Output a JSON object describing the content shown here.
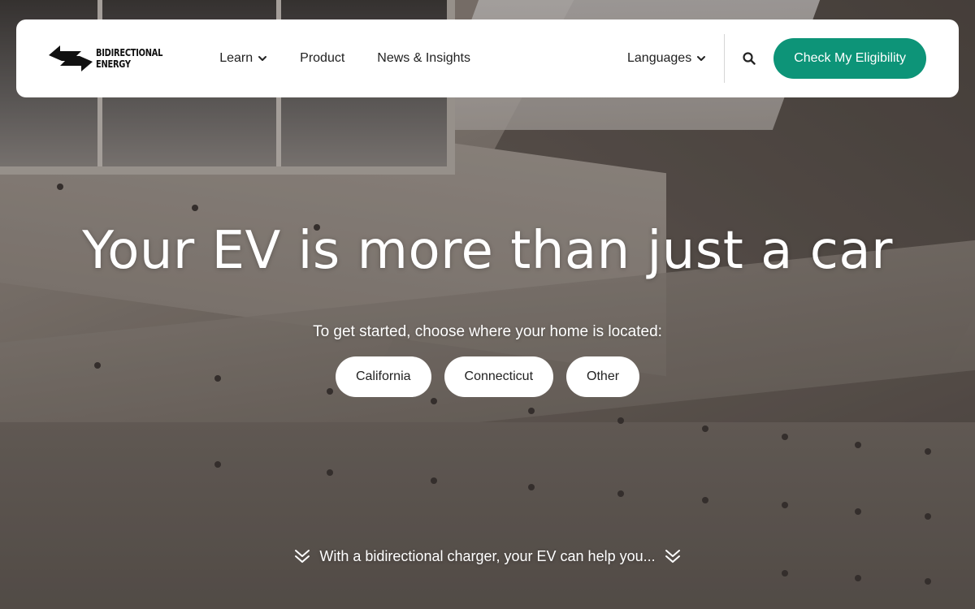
{
  "brand": {
    "name_line1": "BIDIRECTIONAL",
    "name_line2": "ENERGY",
    "logo_icon": "bidirectional-arrows-logo"
  },
  "nav": {
    "items": [
      {
        "label": "Learn",
        "has_dropdown": true
      },
      {
        "label": "Product",
        "has_dropdown": false
      },
      {
        "label": "News & Insights",
        "has_dropdown": false
      }
    ],
    "languages_label": "Languages",
    "search_icon": "search-icon",
    "cta_label": "Check My Eligibility"
  },
  "hero": {
    "title": "Your EV is more than just a car",
    "subtitle": "To get started, choose where your home is located:",
    "locations": [
      "California",
      "Connecticut",
      "Other"
    ],
    "scroll_hint": "With a bidirectional charger, your EV can help you..."
  },
  "colors": {
    "accent": "#0d9478",
    "header_bg": "#ffffff",
    "text_dark": "#222222"
  }
}
